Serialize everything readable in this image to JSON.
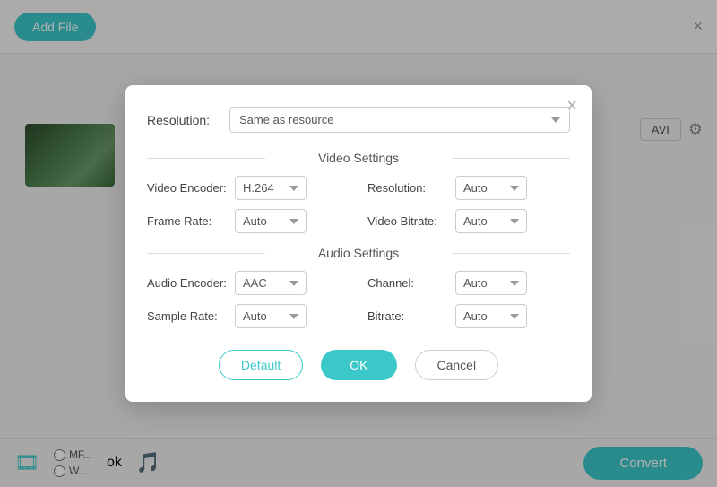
{
  "app": {
    "add_file_label": "Add File",
    "close_label": "×"
  },
  "toolbar": {
    "avi_label": "AVI",
    "convert_label": "Convert"
  },
  "bottom": {
    "radio1": "MF...",
    "radio2": "W...",
    "ok_label": "ok"
  },
  "dialog": {
    "close_label": "×",
    "resolution_top_label": "Resolution:",
    "resolution_top_value": "Same as resource",
    "video_settings_label": "Video Settings",
    "audio_settings_label": "Audio Settings",
    "video_encoder_label": "Video Encoder:",
    "video_encoder_value": "H.264",
    "resolution_label": "Resolution:",
    "resolution_value": "Auto",
    "frame_rate_label": "Frame Rate:",
    "frame_rate_value": "Auto",
    "video_bitrate_label": "Video Bitrate:",
    "video_bitrate_value": "Auto",
    "audio_encoder_label": "Audio Encoder:",
    "audio_encoder_value": "AAC",
    "channel_label": "Channel:",
    "channel_value": "Auto",
    "sample_rate_label": "Sample Rate:",
    "sample_rate_value": "Auto",
    "bitrate_label": "Bitrate:",
    "bitrate_value": "Auto",
    "btn_default": "Default",
    "btn_ok": "OK",
    "btn_cancel": "Cancel"
  }
}
